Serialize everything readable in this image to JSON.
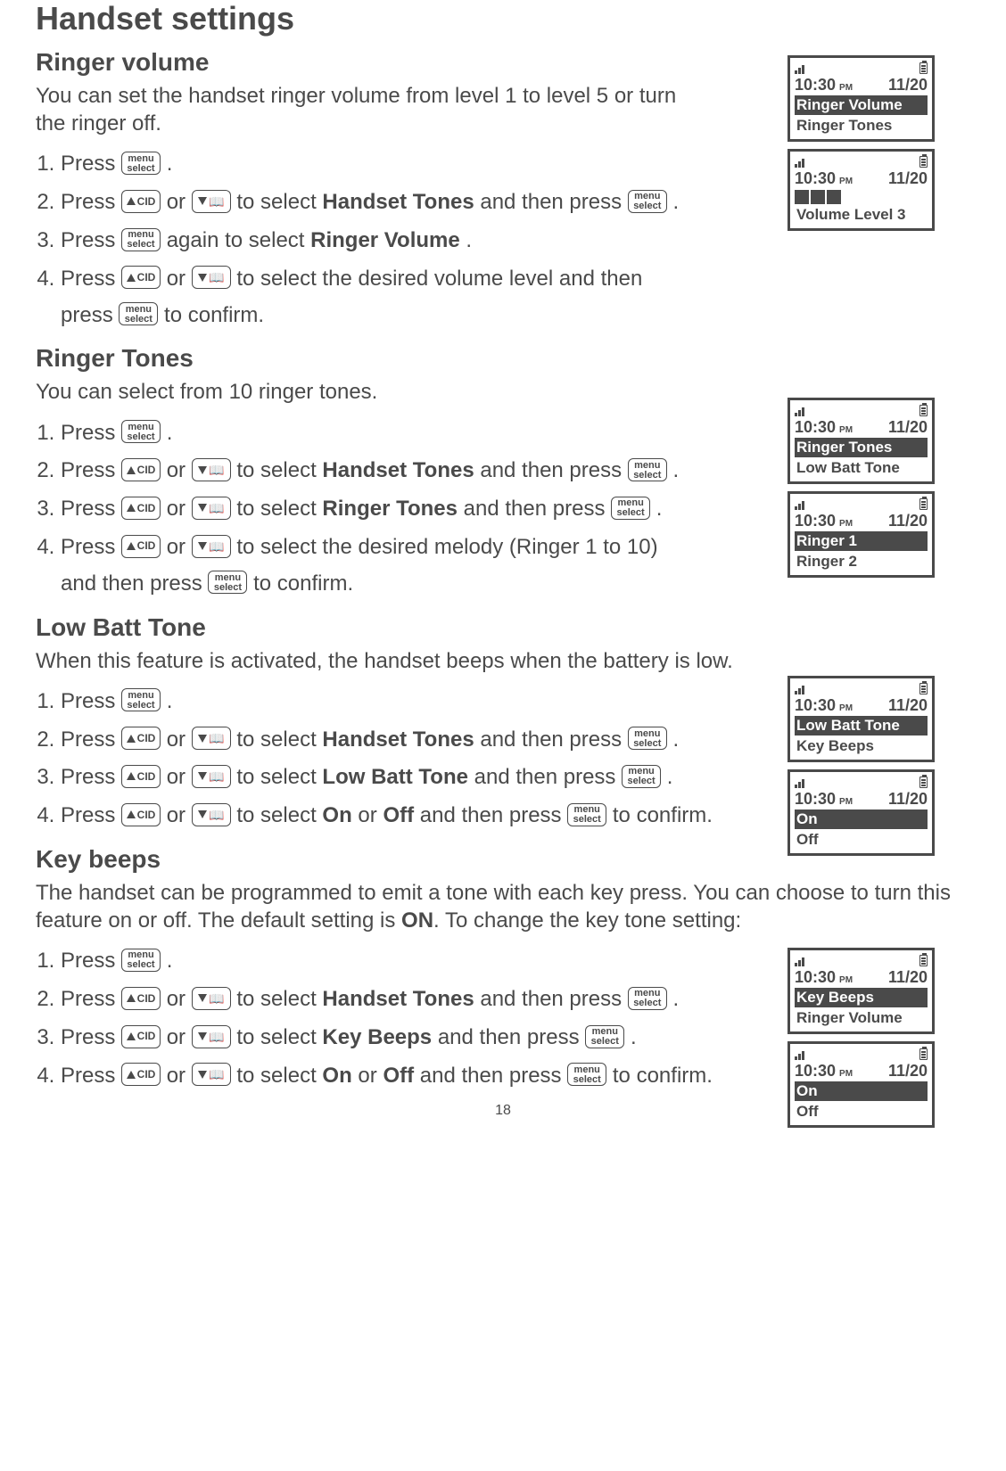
{
  "page_number": "18",
  "title": "Handset settings",
  "common": {
    "time": "10:30",
    "ampm": "PM",
    "date": "11/20"
  },
  "buttons": {
    "menu_top": "menu",
    "menu_bottom": "select",
    "cid_label": "CID"
  },
  "sections": {
    "ringer_volume": {
      "heading": "Ringer volume",
      "intro": "You can set the handset ringer volume from level 1 to level 5 or turn the ringer off.",
      "steps": {
        "s1_a": "Press ",
        "s1_b": ".",
        "s2_a": "Press ",
        "s2_b": " or ",
        "s2_c": " to select ",
        "s2_bold": "Handset Tones",
        "s2_d": " and then press ",
        "s2_e": ".",
        "s3_a": "Press ",
        "s3_b": " again to select ",
        "s3_bold": "Ringer Volume",
        "s3_c": ".",
        "s4_a": "Press ",
        "s4_b": " or ",
        "s4_c": " to select the desired volume level and then press ",
        "s4_d": " to confirm."
      },
      "screens": {
        "a_line1": "Ringer Volume",
        "a_line2": "Ringer Tones",
        "b_line2": "Volume Level 3"
      }
    },
    "ringer_tones": {
      "heading": "Ringer Tones",
      "intro": "You can select from 10 ringer tones.",
      "steps": {
        "s1_a": "Press ",
        "s1_b": ".",
        "s2_a": "Press ",
        "s2_b": " or ",
        "s2_c": " to select ",
        "s2_bold": "Handset Tones",
        "s2_d": " and then press ",
        "s2_e": ".",
        "s3_a": "Press ",
        "s3_b": " or ",
        "s3_c": " to select ",
        "s3_bold": "Ringer Tones",
        "s3_d": " and then press ",
        "s3_e": ".",
        "s4_a": "Press ",
        "s4_b": " or ",
        "s4_c": " to select the desired melody (Ringer 1 to 10) and then press ",
        "s4_d": " to confirm."
      },
      "screens": {
        "a_line1": "Ringer Tones",
        "a_line2": "Low Batt Tone",
        "b_line1": "Ringer 1",
        "b_line2": "Ringer 2"
      }
    },
    "low_batt": {
      "heading": "Low Batt Tone",
      "intro": "When this feature is activated, the handset beeps when the battery is low.",
      "steps": {
        "s1_a": "Press ",
        "s1_b": ".",
        "s2_a": "Press ",
        "s2_b": " or ",
        "s2_c": " to select ",
        "s2_bold": "Handset Tones",
        "s2_d": " and then press ",
        "s2_e": ".",
        "s3_a": "Press ",
        "s3_b": " or ",
        "s3_c": " to select ",
        "s3_bold": "Low Batt Tone",
        "s3_d": " and then press ",
        "s3_e": ".",
        "s4_a": "Press ",
        "s4_b": " or ",
        "s4_c": " to select ",
        "s4_bold1": "On",
        "s4_d": " or ",
        "s4_bold2": "Off",
        "s4_e": " and then press ",
        "s4_f": " to confirm."
      },
      "screens": {
        "a_line1": "Low Batt Tone",
        "a_line2": "Key Beeps",
        "b_line1": "On",
        "b_line2": "Off"
      }
    },
    "key_beeps": {
      "heading": "Key beeps",
      "intro_a": "The handset can be programmed to emit a tone with each key press. You can choose to turn this feature on or off. The default setting is ",
      "intro_bold": "ON",
      "intro_b": ". To change the key tone setting:",
      "steps": {
        "s1_a": "Press ",
        "s1_b": ".",
        "s2_a": "Press ",
        "s2_b": " or ",
        "s2_c": " to select ",
        "s2_bold": "Handset Tones",
        "s2_d": " and then press ",
        "s2_e": ".",
        "s3_a": "Press ",
        "s3_b": " or ",
        "s3_c": " to select ",
        "s3_bold": "Key Beeps",
        "s3_d": " and then press ",
        "s3_e": ".",
        "s4_a": "Press ",
        "s4_b": " or ",
        "s4_c": " to select ",
        "s4_bold1": "On",
        "s4_d": " or ",
        "s4_bold2": "Off",
        "s4_e": " and then press ",
        "s4_f": " to confirm."
      },
      "screens": {
        "a_line1": "Key Beeps",
        "a_line2": "Ringer Volume",
        "b_line1": "On",
        "b_line2": "Off"
      }
    }
  }
}
